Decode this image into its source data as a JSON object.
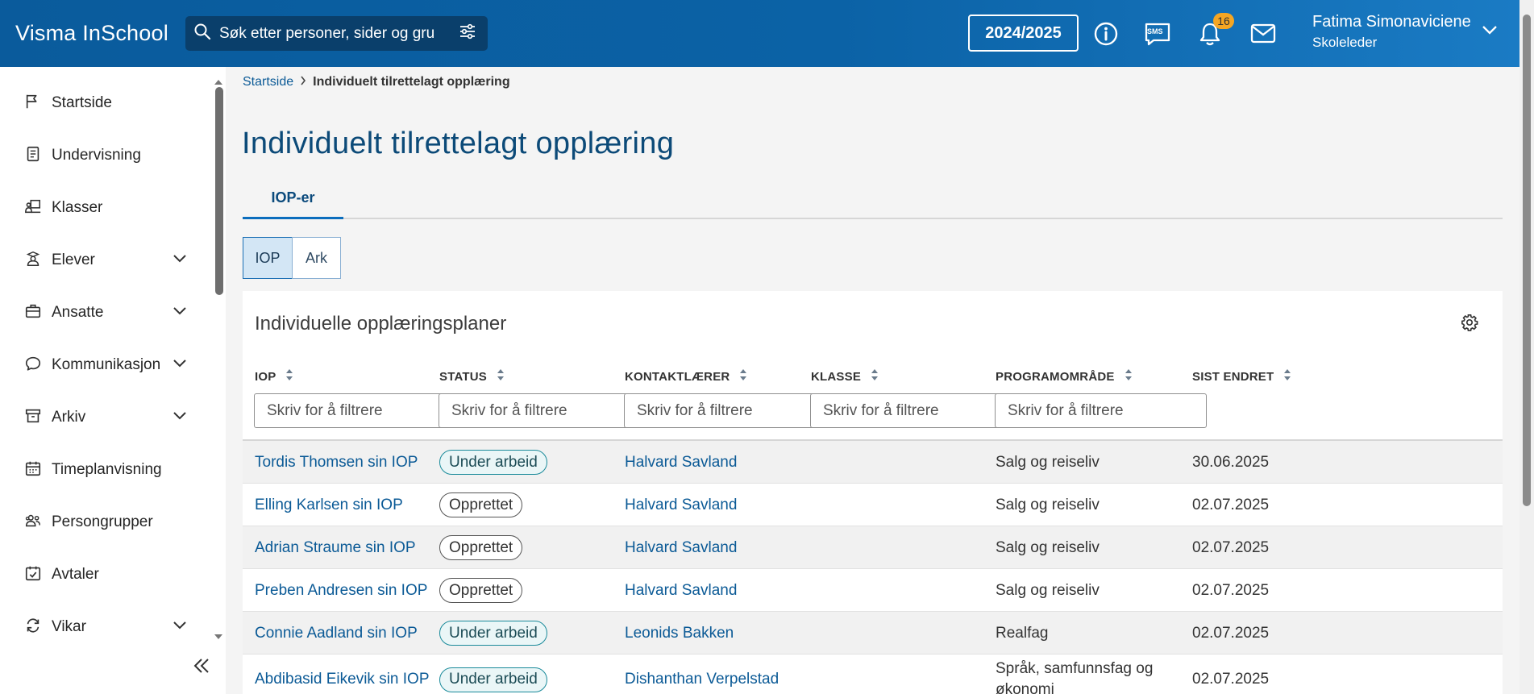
{
  "header": {
    "brand": "Visma InSchool",
    "search_placeholder": "Søk etter personer, sider og gru",
    "year": "2024/2025",
    "notification_count": "16",
    "user_name": "Fatima Simonaviciene",
    "user_role": "Skoleleder",
    "sms_label": "SMS"
  },
  "sidebar": {
    "items": [
      {
        "label": "Startside",
        "icon": "flag-icon",
        "expandable": false
      },
      {
        "label": "Undervisning",
        "icon": "book-icon",
        "expandable": false
      },
      {
        "label": "Klasser",
        "icon": "classroom-icon",
        "expandable": false
      },
      {
        "label": "Elever",
        "icon": "student-icon",
        "expandable": true
      },
      {
        "label": "Ansatte",
        "icon": "briefcase-icon",
        "expandable": true
      },
      {
        "label": "Kommunikasjon",
        "icon": "chat-icon",
        "expandable": true
      },
      {
        "label": "Arkiv",
        "icon": "archive-icon",
        "expandable": true
      },
      {
        "label": "Timeplanvisning",
        "icon": "calendar-icon",
        "expandable": false
      },
      {
        "label": "Persongrupper",
        "icon": "people-icon",
        "expandable": false
      },
      {
        "label": "Avtaler",
        "icon": "calendar-check-icon",
        "expandable": false
      },
      {
        "label": "Vikar",
        "icon": "swap-icon",
        "expandable": true
      }
    ]
  },
  "breadcrumb": {
    "home": "Startside",
    "current": "Individuelt tilrettelagt opplæring"
  },
  "page": {
    "title": "Individuelt tilrettelagt opplæring",
    "tab": "IOP-er",
    "segments": [
      "IOP",
      "Ark"
    ]
  },
  "table": {
    "title": "Individuelle opplæringsplaner",
    "columns": [
      "IOP",
      "STATUS",
      "KONTAKTLÆRER",
      "KLASSE",
      "PROGRAMOMRÅDE",
      "SIST ENDRET"
    ],
    "filter_placeholder": "Skriv for å filtrere",
    "rows": [
      {
        "iop": "Tordis Thomsen sin IOP",
        "status": "Under arbeid",
        "teacher": "Halvard Savland",
        "class": "",
        "program": "Salg og reiseliv",
        "changed": "30.06.2025"
      },
      {
        "iop": "Elling Karlsen sin IOP",
        "status": "Opprettet",
        "teacher": "Halvard Savland",
        "class": "",
        "program": "Salg og reiseliv",
        "changed": "02.07.2025"
      },
      {
        "iop": "Adrian Straume sin IOP",
        "status": "Opprettet",
        "teacher": "Halvard Savland",
        "class": "",
        "program": "Salg og reiseliv",
        "changed": "02.07.2025"
      },
      {
        "iop": "Preben Andresen sin IOP",
        "status": "Opprettet",
        "teacher": "Halvard Savland",
        "class": "",
        "program": "Salg og reiseliv",
        "changed": "02.07.2025"
      },
      {
        "iop": "Connie Aadland sin IOP",
        "status": "Under arbeid",
        "teacher": "Leonids Bakken",
        "class": "",
        "program": "Realfag",
        "changed": "02.07.2025"
      },
      {
        "iop": "Abdibasid Eikevik sin IOP",
        "status": "Under arbeid",
        "teacher": "Dishanthan Verpelstad",
        "class": "",
        "program": "Språk, samfunnsfag og økonomi",
        "changed": "02.07.2025"
      }
    ]
  },
  "colors": {
    "header_bg": "#0b62a6",
    "link": "#0b5a96",
    "title": "#0c4a78",
    "badge": "#f5a623"
  }
}
